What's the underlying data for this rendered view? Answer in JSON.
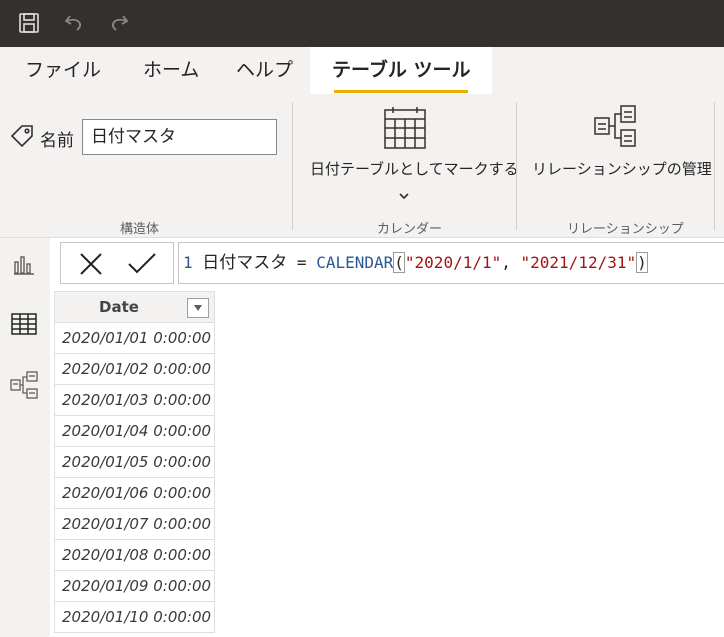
{
  "quick_access": {
    "icons": [
      "save-icon",
      "undo-icon",
      "redo-icon"
    ]
  },
  "tabs": [
    {
      "label": "ファイル"
    },
    {
      "label": "ホーム"
    },
    {
      "label": "ヘルプ"
    },
    {
      "label": "テーブル ツール",
      "active": true
    }
  ],
  "ribbon": {
    "structure": {
      "name_label": "名前",
      "name_value": "日付マスタ",
      "group_label": "構造体"
    },
    "calendar": {
      "mark_label": "日付テーブルとしてマークする",
      "group_label": "カレンダー"
    },
    "relationships": {
      "manage_label": "リレーションシップの管理",
      "group_label": "リレーションシップ"
    }
  },
  "left_nav": [
    "report-view-icon",
    "data-view-icon",
    "model-view-icon"
  ],
  "formula": {
    "line_number": "1",
    "name": "日付マスタ",
    "equals": "=",
    "function": "CALENDAR",
    "open_paren": "(",
    "arg1": "\"2020/1/1\"",
    "comma": ",",
    "arg2": "\"2021/12/31\"",
    "close_paren": ")"
  },
  "table": {
    "column": "Date",
    "rows": [
      "2020/01/01 0:00:00",
      "2020/01/02 0:00:00",
      "2020/01/03 0:00:00",
      "2020/01/04 0:00:00",
      "2020/01/05 0:00:00",
      "2020/01/06 0:00:00",
      "2020/01/07 0:00:00",
      "2020/01/08 0:00:00",
      "2020/01/09 0:00:00",
      "2020/01/10 0:00:00"
    ]
  },
  "colors": {
    "title_bar": "#323130",
    "ribbon_bg": "#f3f2f1",
    "active_tab_underline": "#e8b000",
    "dax_function": "#2b5797",
    "dax_string": "#a31515"
  }
}
